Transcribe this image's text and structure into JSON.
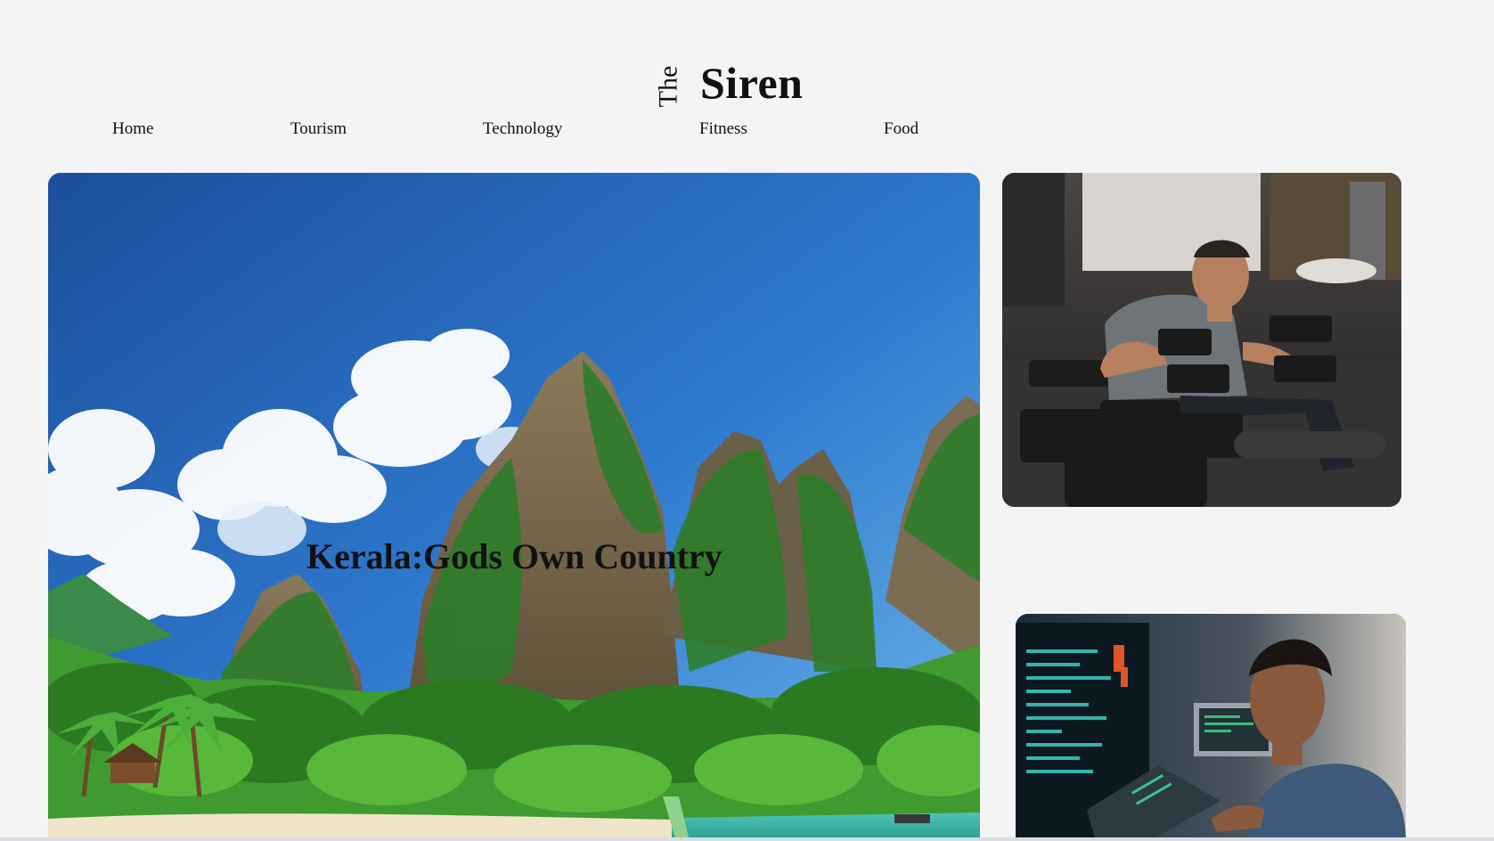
{
  "site": {
    "logo_the": "The",
    "logo_name": "Siren"
  },
  "nav": {
    "items": [
      {
        "label": "Home"
      },
      {
        "label": "Tourism"
      },
      {
        "label": "Technology"
      },
      {
        "label": "Fitness"
      },
      {
        "label": "Food"
      }
    ]
  },
  "featured": {
    "title": "Kerala:Gods Own Country",
    "image_subject": "tropical limestone cliffs with jungle, clouds and blue sky"
  },
  "side_cards": [
    {
      "image_subject": "man lifting dumbbells in a gym"
    },
    {
      "image_subject": "man working at computer with code on screens"
    }
  ],
  "colors": {
    "page_background": "#f4f4f4",
    "text": "#111111",
    "sky_top": "#1c5aa8",
    "sky_bottom": "#5aa6e0",
    "jungle": "#2f8a2a"
  }
}
